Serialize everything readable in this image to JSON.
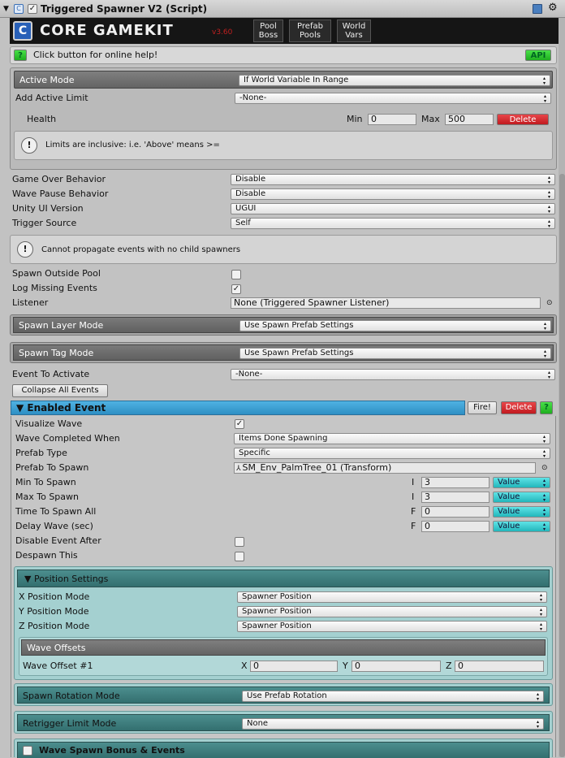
{
  "titlebar": {
    "title": "Triggered Spawner V2 (Script)"
  },
  "banner": {
    "logo": "CORE GAMEKIT",
    "version": "v3.60",
    "pool_boss_1": "Pool",
    "pool_boss_2": "Boss",
    "prefab_pools_1": "Prefab",
    "prefab_pools_2": "Pools",
    "world_vars_1": "World",
    "world_vars_2": "Vars"
  },
  "help": {
    "text": "Click button for online help!",
    "help_btn": "?",
    "api_btn": "API"
  },
  "active": {
    "mode_label": "Active Mode",
    "mode_value": "If World Variable In Range",
    "limit_label": "Add Active Limit",
    "limit_value": "-None-",
    "var_name": "Health",
    "min_label": "Min",
    "min_value": "0",
    "max_label": "Max",
    "max_value": "500",
    "delete_label": "Delete",
    "info": "Limits are inclusive: i.e. 'Above' means >="
  },
  "settings": [
    {
      "label": "Game Over Behavior",
      "value": "Disable"
    },
    {
      "label": "Wave Pause Behavior",
      "value": "Disable"
    },
    {
      "label": "Unity UI Version",
      "value": "UGUI"
    },
    {
      "label": "Trigger Source",
      "value": "Self"
    }
  ],
  "propagate_info": "Cannot propagate events with no child spawners",
  "spawn_outside_pool": {
    "label": "Spawn Outside Pool",
    "checked": false
  },
  "log_missing": {
    "label": "Log Missing Events",
    "checked": true
  },
  "listener": {
    "label": "Listener",
    "value": "None (Triggered Spawner Listener)"
  },
  "layer_mode": {
    "label": "Spawn Layer Mode",
    "value": "Use Spawn Prefab Settings"
  },
  "tag_mode": {
    "label": "Spawn Tag Mode",
    "value": "Use Spawn Prefab Settings"
  },
  "event_activate": {
    "label": "Event To Activate",
    "value": "-None-"
  },
  "collapse_btn": "Collapse All Events",
  "enabled_event": {
    "title": "▼ Enabled Event",
    "fire_btn": "Fire!",
    "delete_btn": "Delete",
    "help_btn": "?"
  },
  "wave": {
    "visualize": {
      "label": "Visualize Wave",
      "checked": true
    },
    "completed": {
      "label": "Wave Completed When",
      "value": "Items Done Spawning"
    },
    "prefab_type": {
      "label": "Prefab Type",
      "value": "Specific"
    },
    "prefab": {
      "label": "Prefab To Spawn",
      "value": "SM_Env_PalmTree_01 (Transform)"
    },
    "numeric": [
      {
        "label": "Min To Spawn",
        "type": "I",
        "value": "3",
        "mode": "Value"
      },
      {
        "label": "Max To Spawn",
        "type": "I",
        "value": "3",
        "mode": "Value"
      },
      {
        "label": "Time To Spawn All",
        "type": "F",
        "value": "0",
        "mode": "Value"
      },
      {
        "label": "Delay Wave (sec)",
        "type": "F",
        "value": "0",
        "mode": "Value"
      }
    ],
    "disable_after": {
      "label": "Disable Event After",
      "checked": false
    },
    "despawn": {
      "label": "Despawn This",
      "checked": false
    }
  },
  "position": {
    "title": "▼ Position Settings",
    "rows": [
      {
        "label": "X Position Mode",
        "value": "Spawner Position"
      },
      {
        "label": "Y Position Mode",
        "value": "Spawner Position"
      },
      {
        "label": "Z Position Mode",
        "value": "Spawner Position"
      }
    ],
    "offsets_title": "Wave Offsets",
    "offset": {
      "label": "Wave Offset #1",
      "x_label": "X",
      "x": "0",
      "y_label": "Y",
      "y": "0",
      "z_label": "Z",
      "z": "0"
    }
  },
  "rotation": {
    "label": "Spawn Rotation Mode",
    "value": "Use Prefab Rotation"
  },
  "retrigger": {
    "label": "Retrigger Limit Mode",
    "value": "None"
  },
  "bonus": {
    "label": "Wave Spawn Bonus & Events"
  },
  "colors": {
    "event_header": "#3b9fd4",
    "teal_panel": "#a4d0d0",
    "teal_header": "#3a7a7a",
    "delete_red": "#c8262b",
    "value_cyan": "#27bcc0",
    "help_green": "#2ecc2e"
  }
}
